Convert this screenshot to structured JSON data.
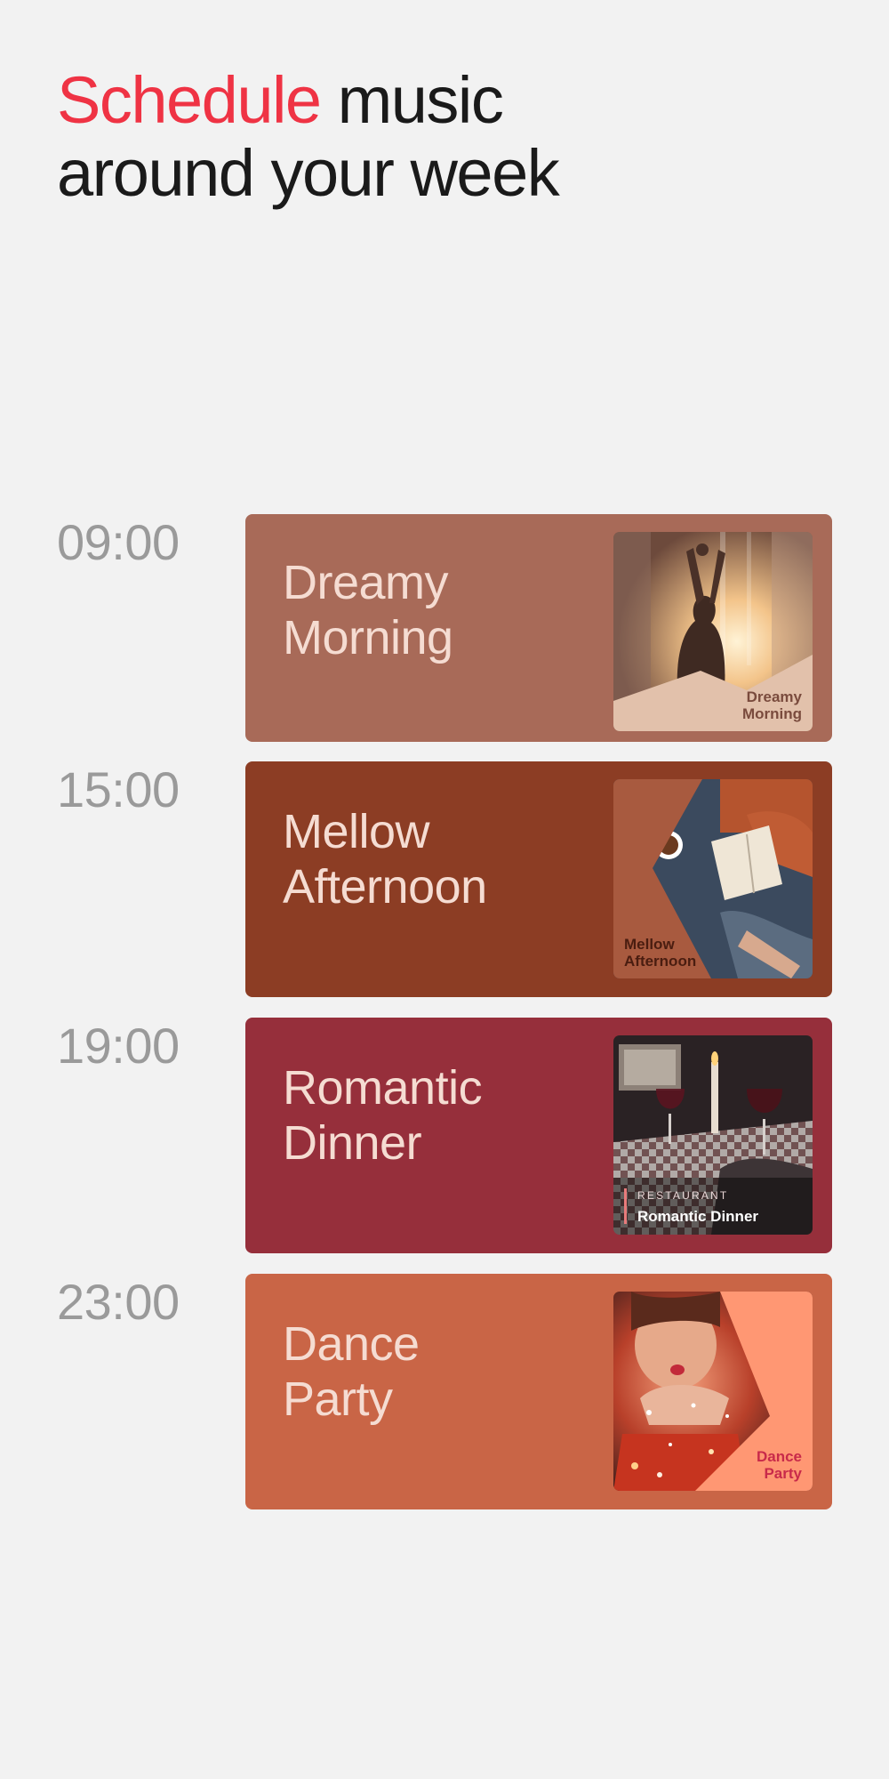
{
  "header": {
    "accent_word": "Schedule",
    "line1_rest": " music",
    "line2": "around your week"
  },
  "schedule": [
    {
      "time": "09:00",
      "title_line1": "Dreamy",
      "title_line2": "Morning",
      "art_label_line1": "Dreamy",
      "art_label_line2": "Morning",
      "card_color": "#a86a58"
    },
    {
      "time": "15:00",
      "title_line1": "Mellow",
      "title_line2": "Afternoon",
      "art_label_line1": "Mellow",
      "art_label_line2": "Afternoon",
      "card_color": "#8c3d24"
    },
    {
      "time": "19:00",
      "title_line1": "Romantic",
      "title_line2": "Dinner",
      "art_kicker": "RESTAURANT",
      "art_label_line1": "Romantic Dinner",
      "card_color": "#962f3b"
    },
    {
      "time": "23:00",
      "title_line1": "Dance",
      "title_line2": "Party",
      "art_label_line1": "Dance",
      "art_label_line2": "Party",
      "card_color": "#c96546"
    }
  ],
  "colors": {
    "background": "#f2f2f2",
    "accent": "#ef3344",
    "headline": "#1a1a1a",
    "time_text": "#9a9a9a",
    "card_title": "#f5dcd2"
  }
}
